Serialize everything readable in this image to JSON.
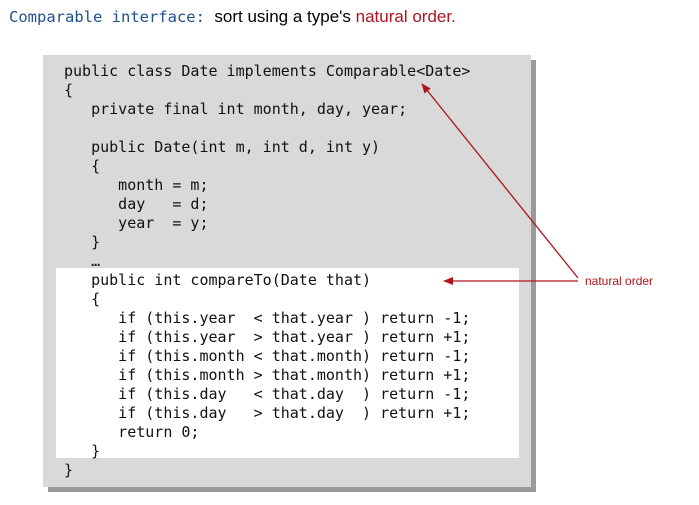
{
  "title": {
    "prefix": "Comparable interface:",
    "middle": "  sort using a type's ",
    "highlight": "natural order."
  },
  "code_lines": [
    "public class Date implements Comparable<Date>",
    "{",
    "   private final int month, day, year;",
    "",
    "   public Date(int m, int d, int y)",
    "   {",
    "      month = m;",
    "      day   = d;",
    "      year  = y;",
    "   }",
    "   …",
    "   public int compareTo(Date that)",
    "   {",
    "      if (this.year  < that.year ) return -1;",
    "      if (this.year  > that.year ) return +1;",
    "      if (this.month < that.month) return -1;",
    "      if (this.month > that.month) return +1;",
    "      if (this.day   < that.day  ) return -1;",
    "      if (this.day   > that.day  ) return +1;",
    "      return 0;",
    "   }",
    "}"
  ],
  "annotation": "natural order",
  "colors": {
    "title_blue": "#1f4f8f",
    "accent_red": "#b0141e",
    "panel_gray": "#d9d9d9",
    "highlight_white": "#ffffff"
  }
}
